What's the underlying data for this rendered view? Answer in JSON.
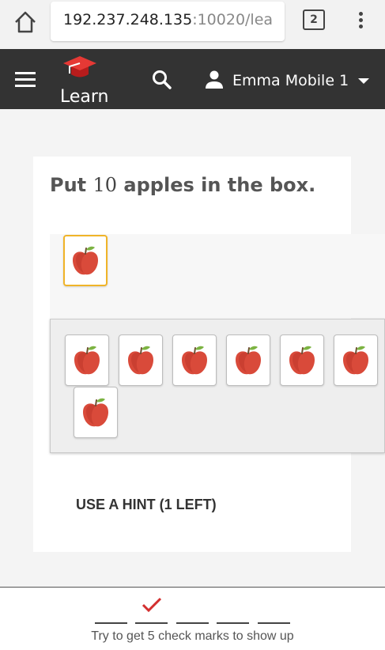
{
  "browser": {
    "url_host": "192.237.248.135",
    "url_rest": ":10020/lea",
    "tab_count": "2",
    "icons": {
      "home": "home-icon",
      "menu": "more-vert-icon"
    }
  },
  "appbar": {
    "title": "Learn",
    "user_name": "Emma Mobile 1",
    "icons": {
      "menu": "hamburger-icon",
      "logo": "graduation-cap-icon",
      "search": "search-icon",
      "user": "person-icon",
      "dropdown": "caret-down-icon"
    },
    "background": "#333333"
  },
  "exercise": {
    "question_prefix": "Put ",
    "question_number": "10",
    "question_suffix": " apples in the box.",
    "answer_items": [
      "apple"
    ],
    "source_items": [
      "apple",
      "apple",
      "apple",
      "apple",
      "apple",
      "apple",
      "apple"
    ],
    "hint_label": "USE A HINT (1 LEFT)"
  },
  "progress": {
    "slots": 5,
    "checked": 1,
    "check_color": "#d32f2f",
    "message": "Try to get 5 check marks to show up"
  }
}
